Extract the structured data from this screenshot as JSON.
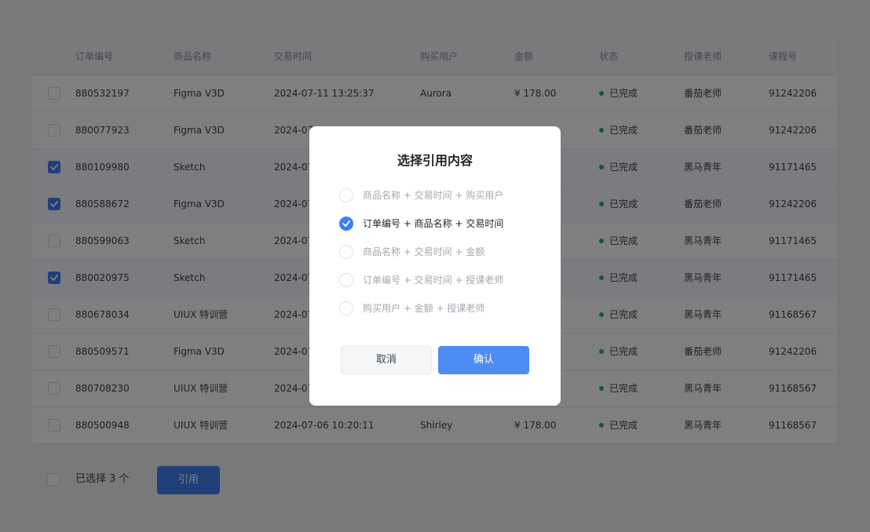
{
  "table": {
    "headers": [
      "订单编号",
      "商品名称",
      "交易时间",
      "购买用户",
      "金额",
      "状态",
      "授课老师",
      "课程号"
    ],
    "rows": [
      {
        "id": "880532197",
        "product": "Figma V3D",
        "time": "2024-07-11 13:25:37",
        "user": "Aurora",
        "amount": "¥ 178.00",
        "status": "已完成",
        "teacher": "番茄老师",
        "course": "91242206",
        "checked": false
      },
      {
        "id": "880077923",
        "product": "Figma V3D",
        "time": "2024-07",
        "user": "",
        "amount": "",
        "status": "已完成",
        "teacher": "番茄老师",
        "course": "91242206",
        "checked": false
      },
      {
        "id": "880109980",
        "product": "Sketch",
        "time": "2024-07",
        "user": "",
        "amount": "",
        "status": "已完成",
        "teacher": "黑马青年",
        "course": "91171465",
        "checked": true
      },
      {
        "id": "880588672",
        "product": "Figma V3D",
        "time": "2024-07",
        "user": "",
        "amount": "",
        "status": "已完成",
        "teacher": "番茄老师",
        "course": "91242206",
        "checked": true
      },
      {
        "id": "880599063",
        "product": "Sketch",
        "time": "2024-07",
        "user": "",
        "amount": "",
        "status": "已完成",
        "teacher": "黑马青年",
        "course": "91171465",
        "checked": false
      },
      {
        "id": "880020975",
        "product": "Sketch",
        "time": "2024-07",
        "user": "",
        "amount": "",
        "status": "已完成",
        "teacher": "黑马青年",
        "course": "91171465",
        "checked": true
      },
      {
        "id": "880678034",
        "product": "UIUX 特训营",
        "time": "2024-07",
        "user": "",
        "amount": "",
        "status": "已完成",
        "teacher": "黑马青年",
        "course": "91168567",
        "checked": false
      },
      {
        "id": "880509571",
        "product": "Figma V3D",
        "time": "2024-07",
        "user": "",
        "amount": "",
        "status": "已完成",
        "teacher": "番茄老师",
        "course": "91242206",
        "checked": false
      },
      {
        "id": "880708230",
        "product": "UIUX 特训营",
        "time": "2024-07",
        "user": "",
        "amount": "",
        "status": "已完成",
        "teacher": "黑马青年",
        "course": "91168567",
        "checked": false
      },
      {
        "id": "880500948",
        "product": "UIUX 特训营",
        "time": "2024-07-06 10:20:11",
        "user": "Shirley",
        "amount": "¥ 178.00",
        "status": "已完成",
        "teacher": "黑马青年",
        "course": "91168567",
        "checked": false
      }
    ]
  },
  "footer": {
    "selected_text": "已选择 3 个",
    "cite_label": "引用"
  },
  "modal": {
    "title": "选择引用内容",
    "options": [
      {
        "label": "商品名称 + 交易时间 + 购买用户",
        "checked": false
      },
      {
        "label": "订单编号 + 商品名称 + 交易时间",
        "checked": true
      },
      {
        "label": "商品名称 + 交易时间 + 金额",
        "checked": false
      },
      {
        "label": "订单编号 + 交易时间 + 授课老师",
        "checked": false
      },
      {
        "label": "购买用户 + 金额 + 授课老师",
        "checked": false
      }
    ],
    "cancel_label": "取消",
    "confirm_label": "确认"
  },
  "colors": {
    "accent": "#3c7ef3",
    "status_dot": "#1ab37a"
  }
}
